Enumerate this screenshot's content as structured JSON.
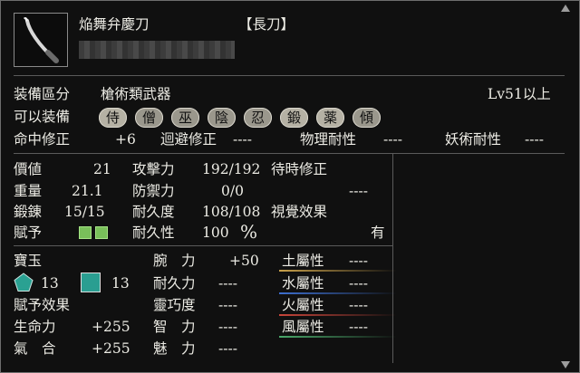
{
  "item": {
    "name": "焔舞弁慶刀",
    "type_bracket": "【長刀】",
    "equip_category_label": "装備區分",
    "equip_category_value": "槍術類武器",
    "level_req": "Lv51以上",
    "can_equip_label": "可以装備",
    "classes": [
      "侍",
      "僧",
      "巫",
      "陰",
      "忍",
      "鍛",
      "薬",
      "傾"
    ]
  },
  "mods_row": {
    "hit_label": "命中修正",
    "hit_value": "+6",
    "evade_label": "迴避修正",
    "evade_value": "----",
    "phys_label": "物理耐性",
    "phys_value": "----",
    "magic_label": "妖術耐性",
    "magic_value": "----"
  },
  "stats_left": [
    {
      "label": "價値",
      "value": "21"
    },
    {
      "label": "重量",
      "value": "21.1"
    },
    {
      "label": "鍛錬",
      "value": "15/15"
    },
    {
      "label": "賦予",
      "value": ""
    }
  ],
  "stats_mid": [
    {
      "label": "攻擊力",
      "value": "192/192"
    },
    {
      "label": "防禦力",
      "value": "0/0"
    },
    {
      "label": "耐久度",
      "value": "108/108"
    },
    {
      "label": "耐久性",
      "value": "100",
      "unit": "%"
    }
  ],
  "stats_right": {
    "wait_label": "待時修正",
    "wait_value": "----",
    "visual_label": "視覺效果",
    "visual_value": "有"
  },
  "gems": {
    "label": "寶玉",
    "pentagon_count": "13",
    "square_count": "13",
    "grant_label": "賦予效果",
    "effects": [
      {
        "label": "生命力",
        "value": "+255"
      },
      {
        "label": "氣　合",
        "value": "+255"
      }
    ]
  },
  "attributes": [
    {
      "label": "腕　力",
      "value": "+50"
    },
    {
      "label": "耐久力",
      "value": "----"
    },
    {
      "label": "靈巧度",
      "value": "----"
    },
    {
      "label": "智　力",
      "value": "----"
    },
    {
      "label": "魅　力",
      "value": "----"
    }
  ],
  "elements": [
    {
      "label": "土屬性",
      "value": "----",
      "color": "#c8a04a"
    },
    {
      "label": "水屬性",
      "value": "----",
      "color": "#3d6fd0"
    },
    {
      "label": "火屬性",
      "value": "----",
      "color": "#c8453a"
    },
    {
      "label": "風屬性",
      "value": "----",
      "color": "#4aa86a"
    }
  ]
}
